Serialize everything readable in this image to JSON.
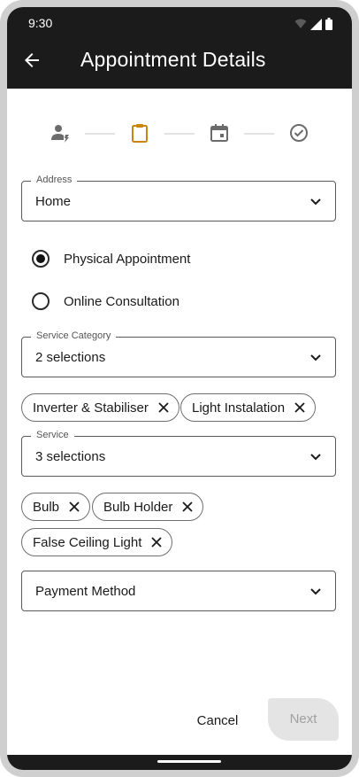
{
  "status": {
    "time": "9:30"
  },
  "header": {
    "title": "Appointment Details"
  },
  "stepper": {
    "icons": [
      "person-icon",
      "clipboard-icon",
      "calendar-icon",
      "check-circle-icon"
    ],
    "active_index": 1,
    "active_color": "#c8860e",
    "inactive_color": "#6b6b6b"
  },
  "address": {
    "label": "Address",
    "value": "Home"
  },
  "appointment_type": {
    "options": [
      {
        "label": "Physical Appointment",
        "selected": true
      },
      {
        "label": "Online Consultation",
        "selected": false
      }
    ]
  },
  "service_category": {
    "label": "Service Category",
    "value": "2 selections",
    "chips": [
      "Inverter & Stabiliser",
      "Light Instalation"
    ]
  },
  "service": {
    "label": "Service",
    "value": "3 selections",
    "chips": [
      "Bulb",
      "Bulb Holder",
      "False Ceiling Light"
    ]
  },
  "payment": {
    "placeholder": "Payment Method"
  },
  "actions": {
    "cancel": "Cancel",
    "next": "Next"
  }
}
